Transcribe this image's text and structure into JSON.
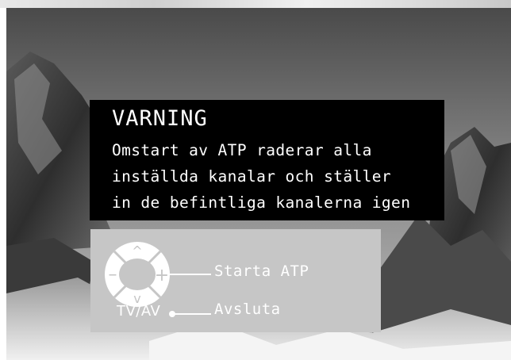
{
  "warning": {
    "title": "VARNING",
    "lines": [
      "Omstart av ATP raderar alla",
      "inställda kanalar och ställer",
      "in de befintliga kanalerna igen"
    ]
  },
  "controls": {
    "start_label": "Starta ATP",
    "exit_label": "Avsluta",
    "tv_label": "TV/AV",
    "up_symbol": "^",
    "down_symbol": "v",
    "minus_symbol": "–",
    "plus_symbol": "+"
  },
  "colors": {
    "warning_bg": "#000000",
    "panel_bg": "#c6c6c6",
    "text": "#ffffff"
  },
  "icons": {
    "remote_dpad": "remote-dpad-icon",
    "connector_dot": "connector-dot-icon"
  }
}
